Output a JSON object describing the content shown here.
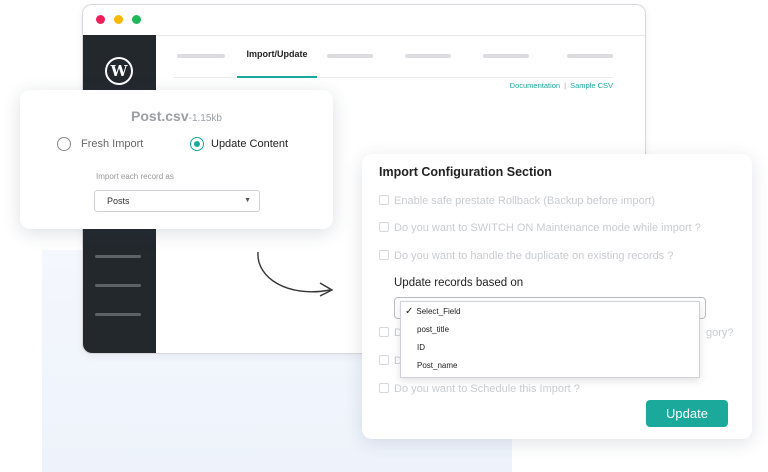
{
  "tabs": {
    "active_label": "Import/Update"
  },
  "links": {
    "documentation": "Documentation",
    "sample_csv": "Sample CSV"
  },
  "import_card": {
    "file_name": "Post.csv",
    "file_size": "-1.15kb",
    "options": [
      {
        "label": "Fresh Import",
        "selected": false
      },
      {
        "label": "Update Content",
        "selected": true
      }
    ],
    "import_as_label": "Import each record as",
    "import_as_value": "Posts"
  },
  "config": {
    "title": "Import Configuration Section",
    "options": [
      "Enable safe prestate Rollback (Backup before import)",
      "Do you want to SWITCH ON Maintenance mode while import ?",
      "Do you want to handle the duplicate on existing records ?"
    ],
    "update_based_on_label": "Update records based on",
    "dropdown_options": [
      {
        "label": "Select_Field",
        "checked": true
      },
      {
        "label": "post_title",
        "checked": false
      },
      {
        "label": "ID",
        "checked": false
      },
      {
        "label": "Post_name",
        "checked": false
      }
    ],
    "partial_option_prefix": "D",
    "partial_option_suffix": "gory?",
    "partial_option_2_prefix": "D",
    "schedule_option": "Do you want to Schedule this Import ?",
    "update_button": "Update"
  },
  "colors": {
    "accent": "#1aa99a",
    "sidebar": "#23282d"
  },
  "icons": {
    "logo": "wordpress-logo-icon",
    "check": "checkmark-icon",
    "arrow": "curved-arrow-icon"
  }
}
